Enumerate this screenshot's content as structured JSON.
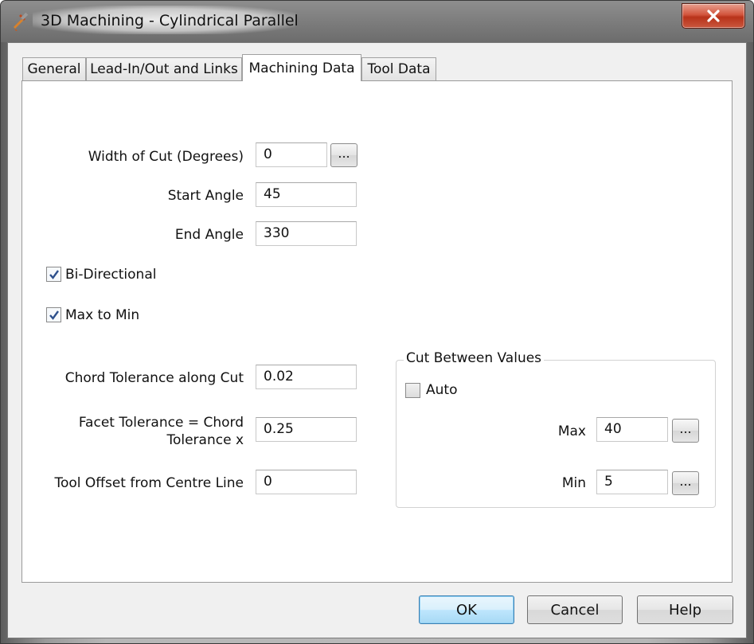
{
  "window": {
    "title": "3D Machining - Cylindrical Parallel"
  },
  "tabs": [
    {
      "label": "General"
    },
    {
      "label": "Lead-In/Out and Links"
    },
    {
      "label": "Machining Data"
    },
    {
      "label": "Tool Data"
    }
  ],
  "fields": {
    "width_of_cut": {
      "label": "Width of Cut (Degrees)",
      "value": "0"
    },
    "start_angle": {
      "label": "Start Angle",
      "value": "45"
    },
    "end_angle": {
      "label": "End Angle",
      "value": "330"
    },
    "chord_tolerance": {
      "label": "Chord Tolerance along Cut",
      "value": "0.02"
    },
    "facet_tolerance": {
      "label_line1": "Facet Tolerance = Chord",
      "label_line2": "Tolerance x",
      "value": "0.25"
    },
    "tool_offset": {
      "label": "Tool Offset from Centre Line",
      "value": "0"
    }
  },
  "checkboxes": {
    "bi_directional": {
      "label": "Bi-Directional",
      "checked": true
    },
    "max_to_min": {
      "label": "Max to Min",
      "checked": true
    }
  },
  "cut_between": {
    "title": "Cut Between Values",
    "auto": {
      "label": "Auto",
      "checked": false
    },
    "max": {
      "label": "Max",
      "value": "40"
    },
    "min": {
      "label": "Min",
      "value": "5"
    }
  },
  "ellipsis_label": "...",
  "buttons": {
    "ok": "OK",
    "cancel": "Cancel",
    "help": "Help"
  }
}
